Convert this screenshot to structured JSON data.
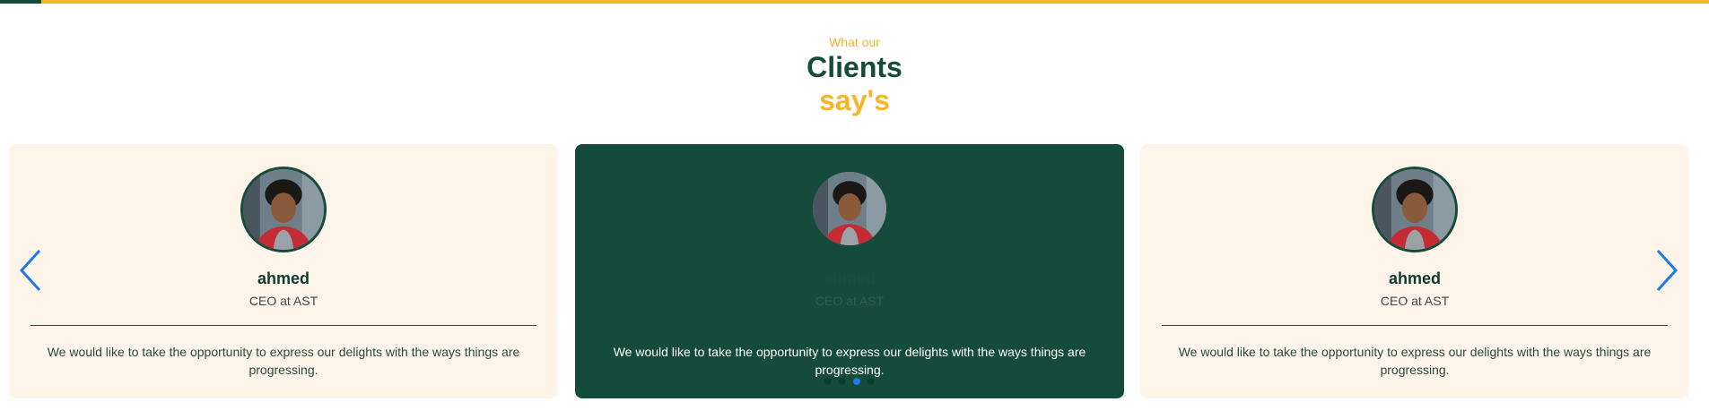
{
  "header": {
    "eyebrow": "What our",
    "title": "Clients",
    "title_accent": "say's"
  },
  "colors": {
    "brand_green": "#154b3a",
    "accent_yellow": "#f7b52a",
    "card_light": "#fef4ea",
    "arrow_blue": "#1a7ae6"
  },
  "carousel": {
    "cards": [
      {
        "name": "ahmed",
        "role": "CEO at AST",
        "quote": "We would like to take the opportunity to express our delights with the ways things are progressing."
      },
      {
        "name": "ahmed",
        "role": "CEO at AST",
        "quote": "We would like to take the opportunity to express our delights with the ways things are progressing."
      },
      {
        "name": "ahmed",
        "role": "CEO at AST",
        "quote": "We would like to take the opportunity to express our delights with the ways things are progressing."
      }
    ],
    "pagination": {
      "count": 4,
      "active_index": 2
    },
    "prev_icon": "chevron-left-icon",
    "next_icon": "chevron-right-icon"
  }
}
